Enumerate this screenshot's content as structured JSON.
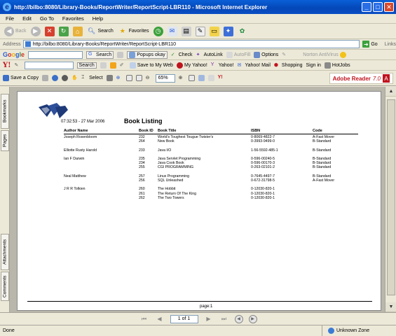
{
  "window": {
    "title": "http://bilbo:8080/Library-Books/ReportWriter/ReportScript-LBR110 - Microsoft Internet Explorer",
    "minimize": "_",
    "maximize": "□",
    "close": "✕"
  },
  "menu": [
    "File",
    "Edit",
    "Go To",
    "Favorites",
    "Help"
  ],
  "toolbar": {
    "back": "Back",
    "search": "Search",
    "favorites": "Favorites"
  },
  "address": {
    "label": "Address",
    "url": "http://bilbo:8080/Library-Books/ReportWriter/ReportScript-LBR110",
    "go": "Go",
    "links": "Links"
  },
  "google": {
    "search": "Search",
    "popups": "Popups okay",
    "check": "Check",
    "autolink": "AutoLink",
    "autofill": "AutoFill",
    "options": "Options",
    "norton": "Norton AntiVirus"
  },
  "yahoo": {
    "search": "Search",
    "save_to_web": "Save to My Web",
    "my_yahoo": "My Yahoo!",
    "yahoo": "Yahoo!",
    "yahoo_mail": "Yahoo! Mail",
    "shopping": "Shopping",
    "sign_in": "Sign in",
    "hotjobs": "HotJobs"
  },
  "acrobat": {
    "save_copy": "Save a Copy",
    "select": "Select",
    "zoom": "65%",
    "adobe_reader": "Adobe Reader",
    "version": "7.0"
  },
  "side_tabs": {
    "bookmarks": "Bookmarks",
    "pages": "Pages",
    "attachments": "Attachments",
    "comments": "Comments"
  },
  "report": {
    "timestamp": "07:32:53 - 27 Mar 2006",
    "title": "Book Listing",
    "columns": [
      "Author Name",
      "Book ID",
      "Book Title",
      "ISBN",
      "Code"
    ],
    "groups": [
      {
        "author": "Joseph Rosenbloom",
        "rows": [
          {
            "id": "232",
            "title": "World's Toughest Tougue Twister's",
            "isbn": "0-8069-4822-7",
            "code": "A-Fast Mover"
          },
          {
            "id": "264",
            "title": "New Book",
            "isbn": "0-3993-9499-0",
            "code": "B-Standard"
          }
        ]
      },
      {
        "author": "Elliotte Rusty Harold",
        "rows": [
          {
            "id": "233",
            "title": "Java I/O",
            "isbn": "1-56-5592-485-1",
            "code": "B-Standard"
          }
        ]
      },
      {
        "author": "Ian F Darwin",
        "rows": [
          {
            "id": "235",
            "title": "Java Servlet Programming",
            "isbn": "0-596-00240-5",
            "code": "B-Standard"
          },
          {
            "id": "234",
            "title": "Java Cook Book",
            "isbn": "0-596-00170-3",
            "code": "B-Standard"
          },
          {
            "id": "255",
            "title": "CGI PROGRAMMING",
            "isbn": "0-263-02101-2",
            "code": "B-Standard"
          }
        ]
      },
      {
        "author": "Neal Matthew",
        "rows": [
          {
            "id": "257",
            "title": "Linux Programming",
            "isbn": "0-7645-4497-7",
            "code": "B-Standard"
          },
          {
            "id": "256",
            "title": "SQL Unleashed",
            "isbn": "0-672-31798-5",
            "code": "A-Fast Mover"
          }
        ]
      },
      {
        "author": "J R R Tolkien",
        "rows": [
          {
            "id": "260",
            "title": "The Hobbit",
            "isbn": "0-12030-820-1",
            "code": ""
          },
          {
            "id": "261",
            "title": "The Return Of The King",
            "isbn": "0-12030-820-1",
            "code": ""
          },
          {
            "id": "262",
            "title": "The Two Towers",
            "isbn": "0-12030-820-1",
            "code": ""
          }
        ]
      }
    ],
    "footer": "page:1"
  },
  "nav": {
    "page_indicator": "1 of 1"
  },
  "status": {
    "left": "Done",
    "zone": "Unknown Zone"
  }
}
